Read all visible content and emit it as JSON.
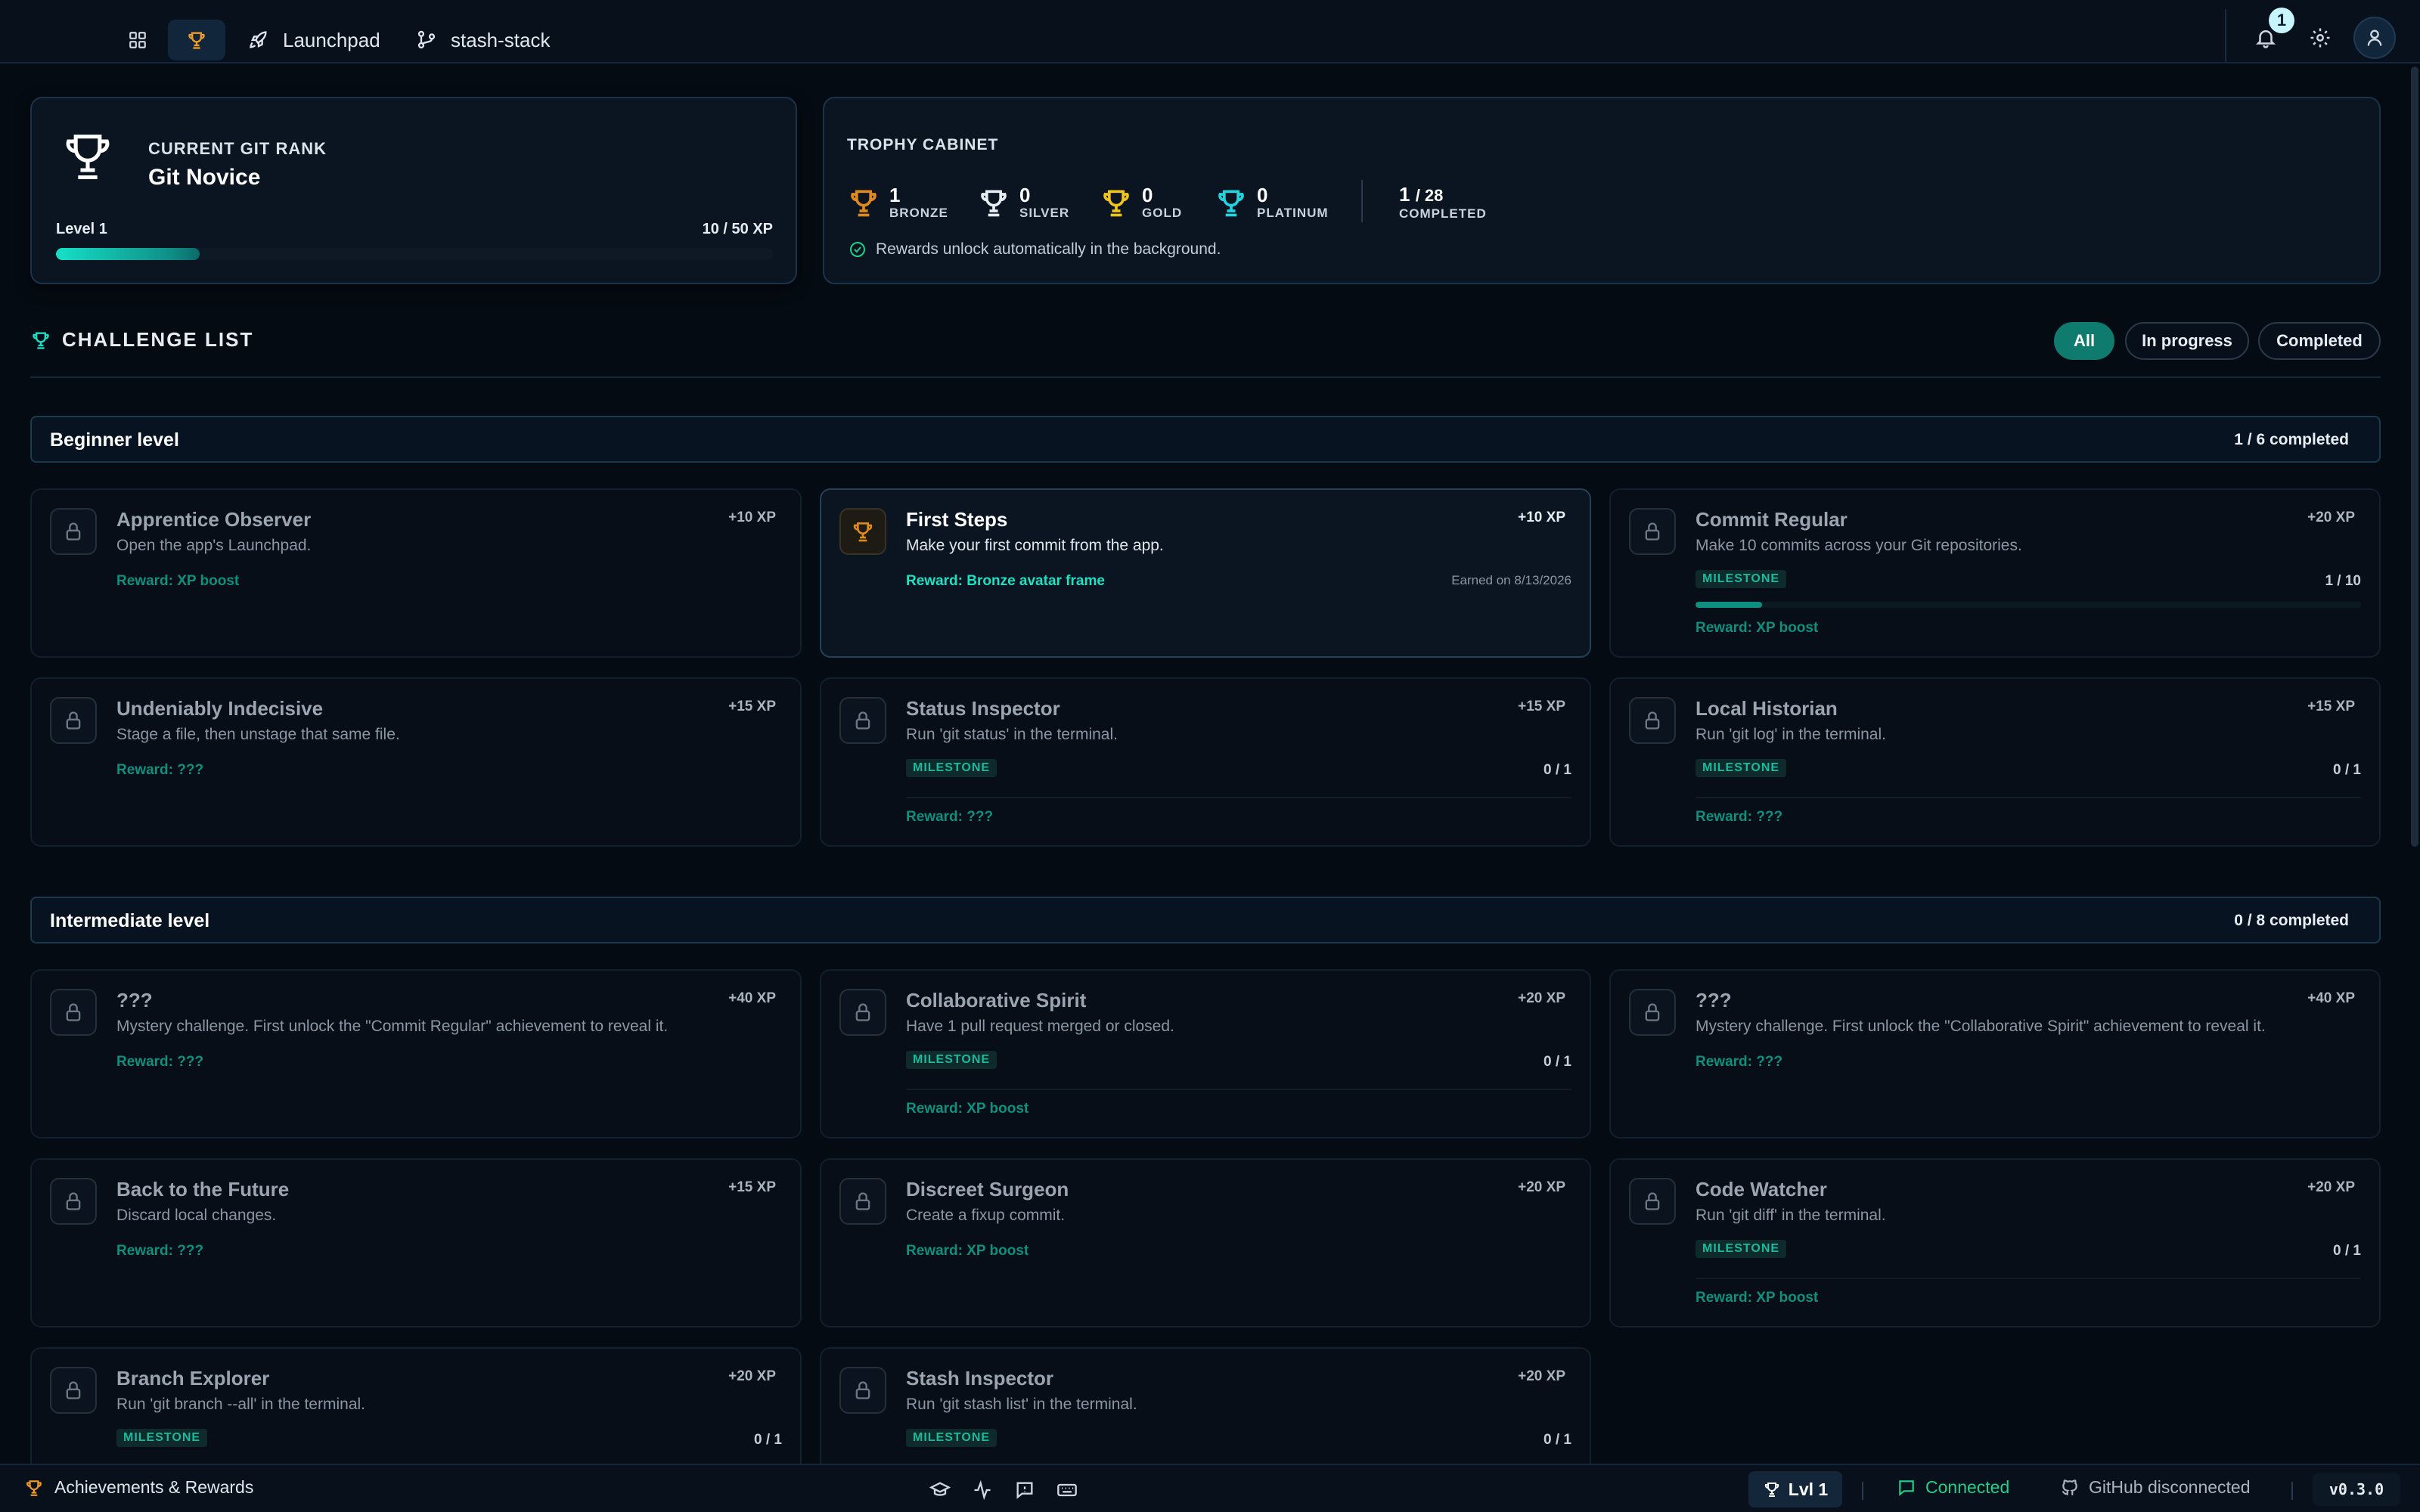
{
  "colors": {
    "accent": "#16e0c8",
    "bronze": "#e08a1e",
    "silver": "#e6edf3",
    "gold": "#f0c419",
    "platinum": "#1fd6e0",
    "connected": "#1fd08a"
  },
  "topbar": {
    "launchpad_label": "Launchpad",
    "repo_label": "stash-stack",
    "notification_count": "1"
  },
  "rank": {
    "caption": "CURRENT GIT RANK",
    "title": "Git Novice",
    "level": "Level 1",
    "xp": "10 / 50 XP",
    "progress": 0.2
  },
  "trophy_cabinet": {
    "caption": "TROPHY CABINET",
    "bronze": {
      "count": "1",
      "label": "BRONZE"
    },
    "silver": {
      "count": "0",
      "label": "SILVER"
    },
    "gold": {
      "count": "0",
      "label": "GOLD"
    },
    "platinum": {
      "count": "0",
      "label": "PLATINUM"
    },
    "completed": {
      "done": "1",
      "total": "/ 28",
      "label": "COMPLETED"
    },
    "note": "Rewards unlock automatically in the background."
  },
  "challenges": {
    "title": "CHALLENGE LIST",
    "filters": [
      "All",
      "In progress",
      "Completed"
    ]
  },
  "levels": [
    {
      "name": "Beginner level",
      "count": "1 / 6 completed",
      "items": [
        {
          "title": "Apprentice Observer",
          "desc": "Open the app's Launchpad.",
          "xp": "+10 XP",
          "reward": "Reward: XP boost"
        },
        {
          "title": "First Steps",
          "desc": "Make your first commit from the app.",
          "xp": "+10 XP",
          "reward": "Reward: Bronze avatar frame",
          "earned_on": "Earned on 8/13/2026"
        },
        {
          "title": "Commit Regular",
          "desc": "Make 10 commits across your Git repositories.",
          "xp": "+20 XP",
          "badge": "MILESTONE",
          "progress": "1 / 10",
          "progress_value": 0.1,
          "reward": "Reward: XP boost"
        },
        {
          "title": "Undeniably Indecisive",
          "desc": "Stage a file, then unstage that same file.",
          "xp": "+15 XP",
          "reward": "Reward: ???"
        },
        {
          "title": "Status Inspector",
          "desc": "Run 'git status' in the terminal.",
          "xp": "+15 XP",
          "badge": "MILESTONE",
          "progress": "0 / 1",
          "reward": "Reward: ???"
        },
        {
          "title": "Local Historian",
          "desc": "Run 'git log' in the terminal.",
          "xp": "+15 XP",
          "badge": "MILESTONE",
          "progress": "0 / 1",
          "reward": "Reward: ???"
        }
      ]
    },
    {
      "name": "Intermediate level",
      "count": "0 / 8 completed",
      "items": [
        {
          "title": "???",
          "desc": "Mystery challenge. First unlock the \"Commit Regular\" achievement to reveal it.",
          "xp": "+40 XP",
          "reward": "Reward: ???"
        },
        {
          "title": "Collaborative Spirit",
          "desc": "Have 1 pull request merged or closed.",
          "xp": "+20 XP",
          "badge": "MILESTONE",
          "progress": "0 / 1",
          "reward": "Reward: XP boost"
        },
        {
          "title": "???",
          "desc": "Mystery challenge. First unlock the \"Collaborative Spirit\" achievement to reveal it.",
          "xp": "+40 XP",
          "reward": "Reward: ???"
        },
        {
          "title": "Back to the Future",
          "desc": "Discard local changes.",
          "xp": "+15 XP",
          "reward": "Reward: ???"
        },
        {
          "title": "Discreet Surgeon",
          "desc": "Create a fixup commit.",
          "xp": "+20 XP",
          "reward": "Reward: XP boost"
        },
        {
          "title": "Code Watcher",
          "desc": "Run 'git diff' in the terminal.",
          "xp": "+20 XP",
          "badge": "MILESTONE",
          "progress": "0 / 1",
          "reward": "Reward: XP boost"
        },
        {
          "title": "Branch Explorer",
          "desc": "Run 'git branch --all' in the terminal.",
          "xp": "+20 XP",
          "badge": "MILESTONE",
          "progress": "0 / 1"
        },
        {
          "title": "Stash Inspector",
          "desc": "Run 'git stash list' in the terminal.",
          "xp": "+20 XP",
          "badge": "MILESTONE",
          "progress": "0 / 1"
        }
      ]
    }
  ],
  "statusbar": {
    "section_label": "Achievements & Rewards",
    "level_label": "Lvl 1",
    "connected_label": "Connected",
    "github_label": "GitHub disconnected",
    "version": "v0.3.0"
  }
}
